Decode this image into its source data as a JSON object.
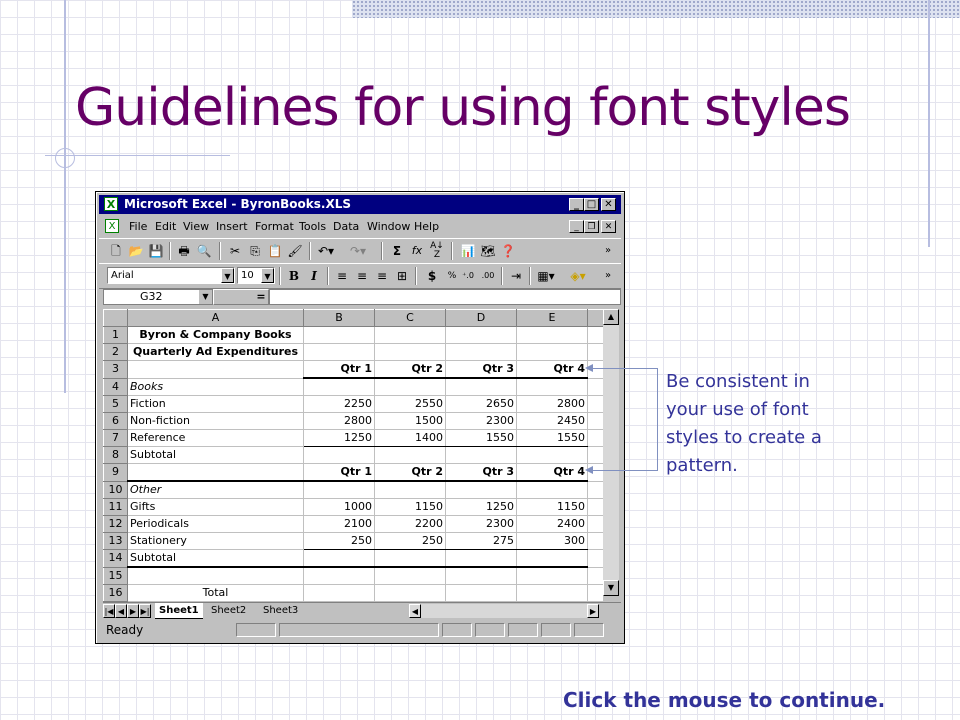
{
  "slide": {
    "title": "Guidelines for using font styles",
    "callout": "Be consistent in your use of font styles to create a pattern.",
    "continue_text": "Click the mouse to continue.",
    "colors": {
      "title": "#660066",
      "callout": "#333399",
      "excel_title": "#000080"
    }
  },
  "excel": {
    "window_title": "Microsoft Excel - ByronBooks.XLS",
    "menus": [
      "File",
      "Edit",
      "View",
      "Insert",
      "Format",
      "Tools",
      "Data",
      "Window",
      "Help"
    ],
    "font_name": "Arial",
    "font_size": "10",
    "name_box": "G32",
    "formula_eq": "=",
    "columns": [
      "A",
      "B",
      "C",
      "D",
      "E"
    ],
    "rows": [
      {
        "n": "1",
        "a": "Byron & Company Books",
        "b": "",
        "c": "",
        "d": "",
        "e": ""
      },
      {
        "n": "2",
        "a": "Quarterly Ad Expenditures",
        "b": "",
        "c": "",
        "d": "",
        "e": ""
      },
      {
        "n": "3",
        "a": "",
        "b": "Qtr 1",
        "c": "Qtr 2",
        "d": "Qtr 3",
        "e": "Qtr 4"
      },
      {
        "n": "4",
        "a": "Books",
        "b": "",
        "c": "",
        "d": "",
        "e": ""
      },
      {
        "n": "5",
        "a": "Fiction",
        "b": "2250",
        "c": "2550",
        "d": "2650",
        "e": "2800"
      },
      {
        "n": "6",
        "a": "Non-fiction",
        "b": "2800",
        "c": "1500",
        "d": "2300",
        "e": "2450"
      },
      {
        "n": "7",
        "a": "Reference",
        "b": "1250",
        "c": "1400",
        "d": "1550",
        "e": "1550"
      },
      {
        "n": "8",
        "a": "Subtotal",
        "b": "",
        "c": "",
        "d": "",
        "e": ""
      },
      {
        "n": "9",
        "a": "",
        "b": "Qtr 1",
        "c": "Qtr 2",
        "d": "Qtr 3",
        "e": "Qtr 4"
      },
      {
        "n": "10",
        "a": "Other",
        "b": "",
        "c": "",
        "d": "",
        "e": ""
      },
      {
        "n": "11",
        "a": "Gifts",
        "b": "1000",
        "c": "1150",
        "d": "1250",
        "e": "1150"
      },
      {
        "n": "12",
        "a": "Periodicals",
        "b": "2100",
        "c": "2200",
        "d": "2300",
        "e": "2400"
      },
      {
        "n": "13",
        "a": "Stationery",
        "b": "250",
        "c": "250",
        "d": "275",
        "e": "300"
      },
      {
        "n": "14",
        "a": "Subtotal",
        "b": "",
        "c": "",
        "d": "",
        "e": ""
      },
      {
        "n": "15",
        "a": "",
        "b": "",
        "c": "",
        "d": "",
        "e": ""
      },
      {
        "n": "16",
        "a": "Total",
        "b": "",
        "c": "",
        "d": "",
        "e": ""
      }
    ],
    "sheet_tabs": [
      "Sheet1",
      "Sheet2",
      "Sheet3"
    ],
    "status": "Ready",
    "icons": [
      "new-icon",
      "open-icon",
      "save-icon",
      "print-icon",
      "print-preview-icon",
      "cut-icon",
      "copy-icon",
      "paste-icon",
      "format-painter-icon",
      "undo-icon",
      "redo-icon",
      "autosum-icon",
      "function-icon",
      "sort-ascending-icon",
      "chart-wizard-icon",
      "map-icon",
      "help-icon"
    ]
  }
}
